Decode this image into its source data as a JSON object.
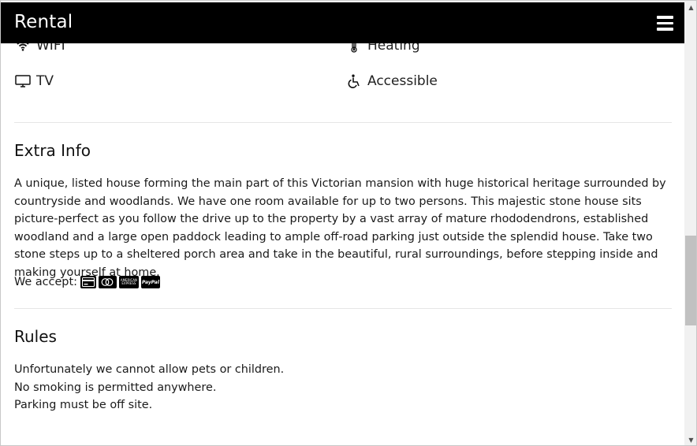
{
  "header": {
    "brand": "Rental"
  },
  "amenities": [
    {
      "label": "WIFI",
      "icon": "wifi-icon"
    },
    {
      "label": "Heating",
      "icon": "thermometer-icon"
    },
    {
      "label": "TV",
      "icon": "tv-icon"
    },
    {
      "label": "Accessible",
      "icon": "wheelchair-icon"
    }
  ],
  "extra_info": {
    "title": "Extra Info",
    "description": "A unique, listed house forming the main part of this Victorian mansion with huge historical heritage surrounded by countryside and woodlands. We have one room available for up to two persons. This majestic stone house sits picture-perfect as you follow the drive up to the property by a vast array of mature rhododendrons, established woodland and a large open paddock leading to ample off-road parking just outside the splendid house. Take two stone steps up to a sheltered porch area and take in the beautiful, rural surroundings, before stepping inside and making yourself at home.",
    "we_accept_label": "We accept:",
    "payment_methods": [
      {
        "name": "credit-card-icon",
        "text": ""
      },
      {
        "name": "mastercard-icon",
        "text": ""
      },
      {
        "name": "amex-icon",
        "text": "AMERICAN EXPRESS"
      },
      {
        "name": "paypal-icon",
        "text": "PayPal"
      }
    ]
  },
  "rules": {
    "title": "Rules",
    "items": [
      "Unfortunately we cannot allow pets or children.",
      "No smoking is permitted anywhere.",
      "Parking must be off site."
    ]
  }
}
